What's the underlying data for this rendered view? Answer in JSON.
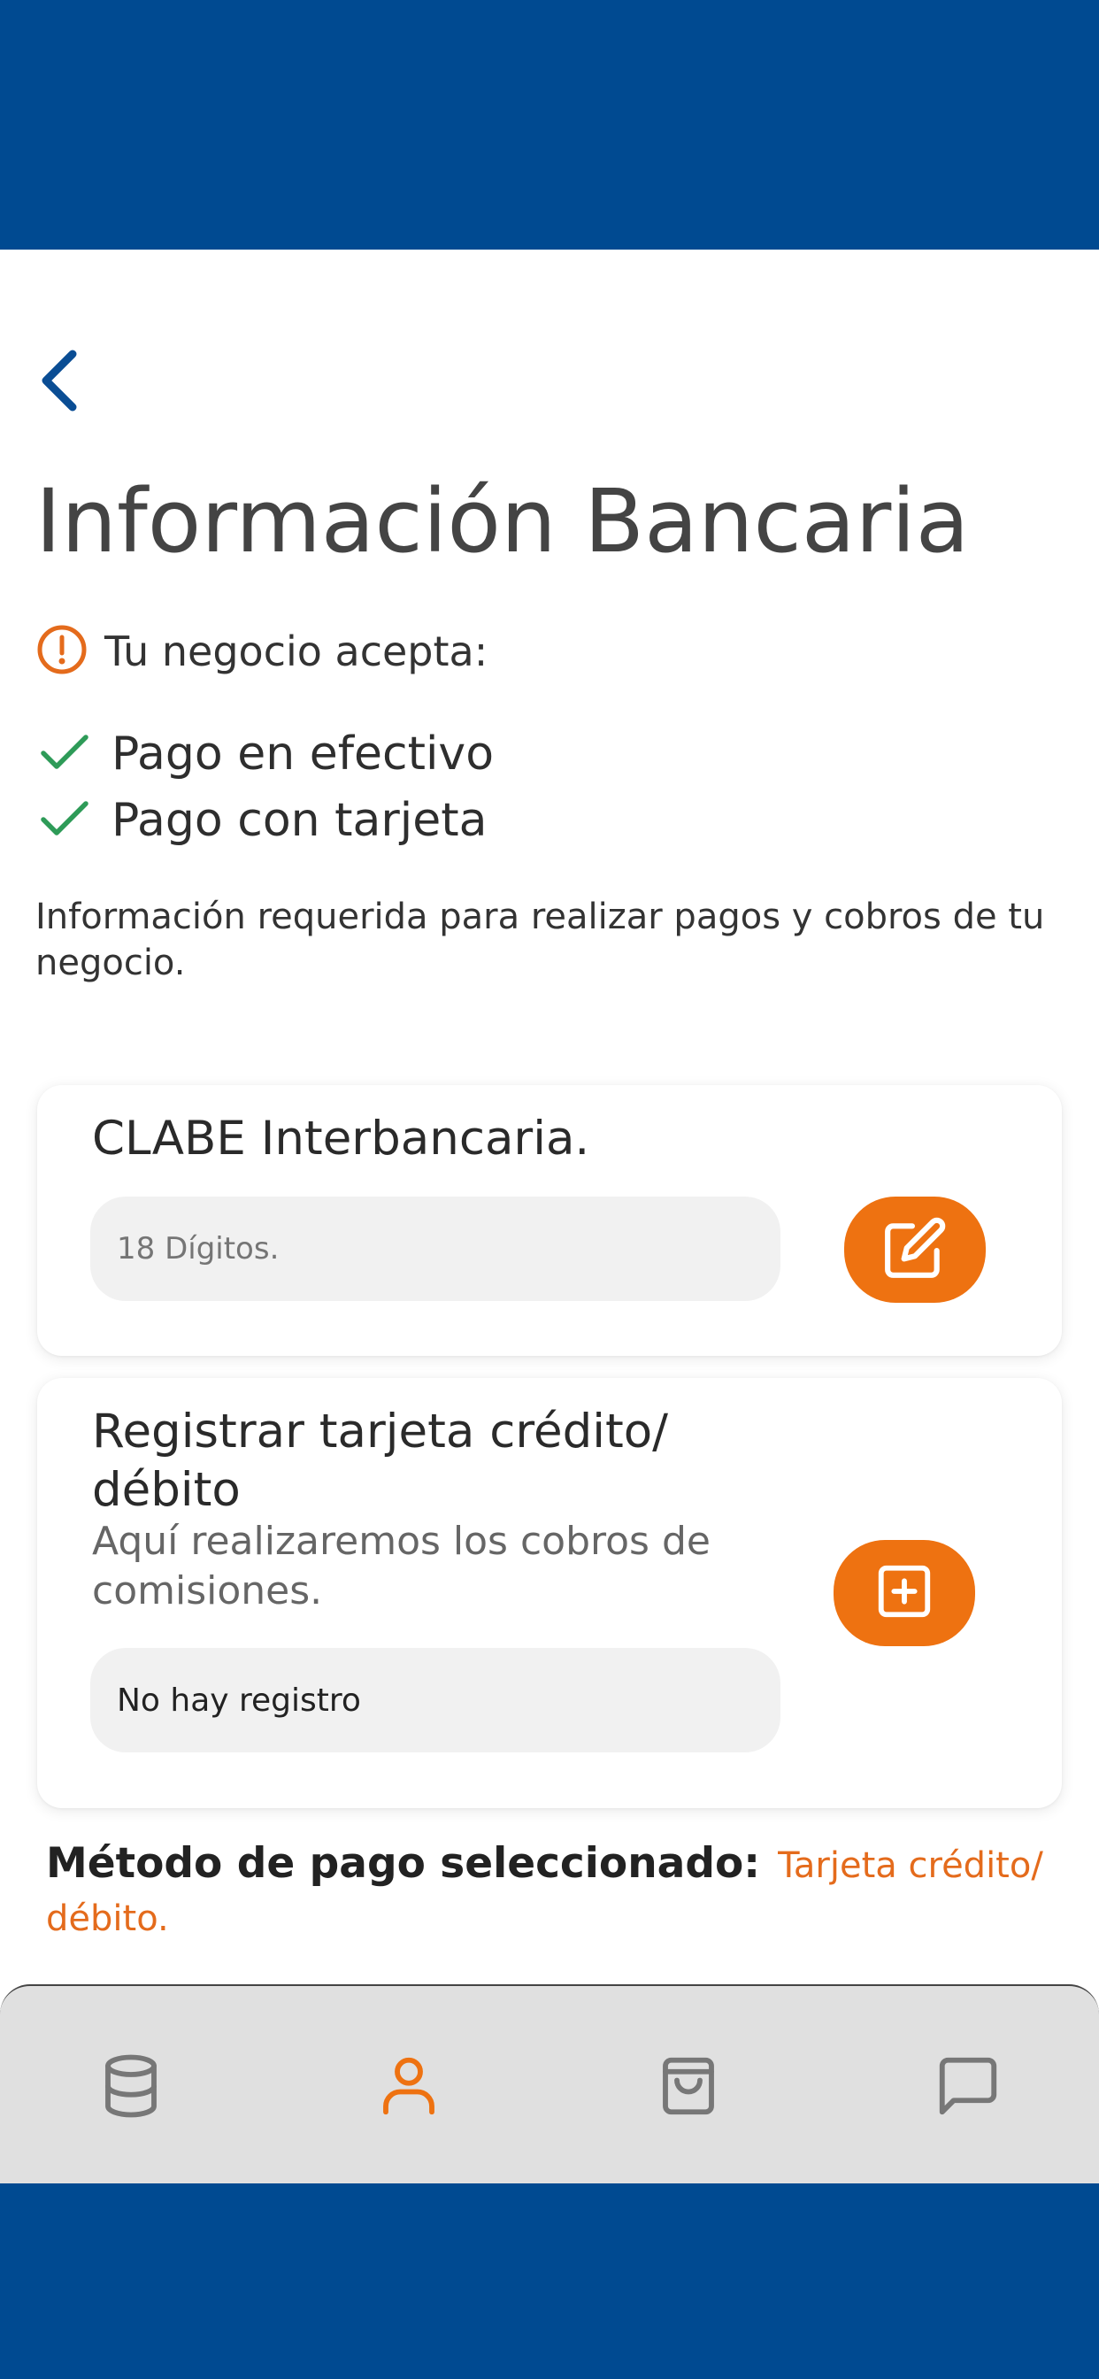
{
  "header": {
    "title": "Información Bancaria"
  },
  "accepts": {
    "label": "Tu negocio acepta:",
    "methods": [
      "Pago en efectivo",
      "Pago con tarjeta"
    ]
  },
  "description": "Información requerida para realizar pagos y cobros de tu negocio.",
  "clabe_card": {
    "title": "CLABE Interbancaria.",
    "input_placeholder": "18 Dígitos.",
    "input_value": ""
  },
  "card_register": {
    "title_line1": "Registrar tarjeta crédito/",
    "title_line2": "débito",
    "subtitle_line1": "Aquí realizaremos los cobros de",
    "subtitle_line2": "comisiones.",
    "status_value": "No hay registro"
  },
  "selected_payment": {
    "label": "Método de pago seleccionado:",
    "value": "Tarjeta crédito/ débito."
  },
  "tabbar": {
    "tabs": [
      {
        "icon": "database-icon",
        "active": false
      },
      {
        "icon": "user-icon",
        "active": true
      },
      {
        "icon": "shopping-bag-icon",
        "active": false
      },
      {
        "icon": "message-icon",
        "active": false
      }
    ]
  },
  "colors": {
    "brand_blue": "#004a91",
    "accent_orange": "#ee7211",
    "check_green": "#2e9b58",
    "tabbar_bg": "#e0e0e0"
  }
}
